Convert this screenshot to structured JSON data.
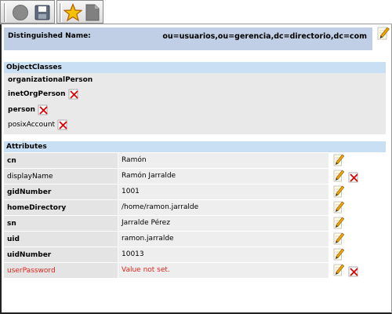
{
  "toolbar": {
    "buttons": [
      "record-icon",
      "save-icon",
      "favorite-star-icon",
      "document-icon"
    ]
  },
  "dn": {
    "label": "Distinguished Name:",
    "value": "ou=usuarios,ou=gerencia,dc=directorio,dc=com"
  },
  "objectclasses": {
    "header": "ObjectClasses",
    "items": [
      {
        "name": "organizationalPerson",
        "bold": true,
        "deletable": false
      },
      {
        "name": "inetOrgPerson",
        "bold": true,
        "deletable": true
      },
      {
        "name": "person",
        "bold": true,
        "deletable": true
      },
      {
        "name": "posixAccount",
        "bold": false,
        "deletable": true
      }
    ]
  },
  "attributes": {
    "header": "Attributes",
    "rows": [
      {
        "name": "cn",
        "value": "Ramón",
        "bold": true,
        "deletable": false,
        "alert": false
      },
      {
        "name": "displayName",
        "value": "Ramón Jarralde",
        "bold": false,
        "deletable": true,
        "alert": false
      },
      {
        "name": "gidNumber",
        "value": "1001",
        "bold": true,
        "deletable": false,
        "alert": false
      },
      {
        "name": "homeDirectory",
        "value": "/home/ramon.jarralde",
        "bold": true,
        "deletable": false,
        "alert": false
      },
      {
        "name": "sn",
        "value": "Jarralde Pérez",
        "bold": true,
        "deletable": false,
        "alert": false
      },
      {
        "name": "uid",
        "value": "ramon.jarralde",
        "bold": true,
        "deletable": false,
        "alert": false
      },
      {
        "name": "uidNumber",
        "value": "10013",
        "bold": true,
        "deletable": false,
        "alert": false
      },
      {
        "name": "userPassword",
        "value": "Value not set.",
        "bold": false,
        "deletable": true,
        "alert": true
      }
    ]
  },
  "colors": {
    "dn_background": "#c0cfe6",
    "section_header": "#c9dff3",
    "alert_text": "#e0261e"
  }
}
